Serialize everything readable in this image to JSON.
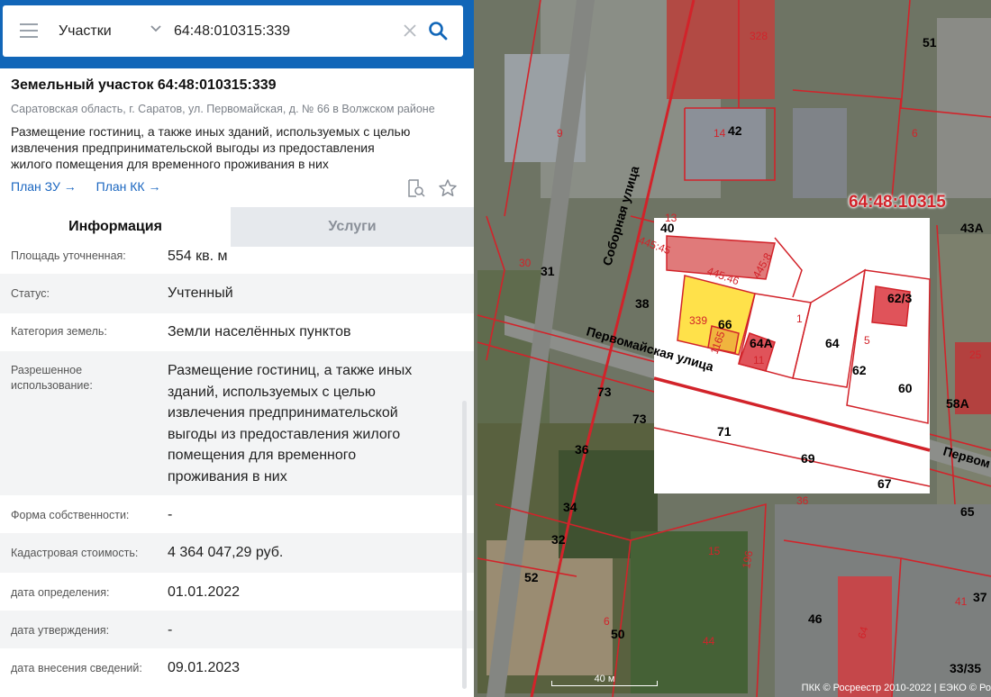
{
  "search": {
    "type_label": "Участки",
    "query": "64:48:010315:339"
  },
  "object": {
    "title": "Земельный участок 64:48:010315:339",
    "address": "Саратовская область, г. Саратов, ул. Первомайская, д. № 66 в Волжском районе",
    "purpose_lines": [
      "Размещение гостиниц, а также иных зданий, используемых с целью",
      "извлечения предпринимательской выгоды из предоставления",
      "жилого помещения для временного проживания в них"
    ],
    "links": [
      "План ЗУ →",
      "План КК →"
    ]
  },
  "tabs": [
    "Информация",
    "Услуги"
  ],
  "info_rows": [
    {
      "key": "Площадь уточненная:",
      "value": "554 кв. м"
    },
    {
      "key": "Статус:",
      "value": "Учтенный"
    },
    {
      "key": "Категория земель:",
      "value": "Земли населённых пунктов"
    },
    {
      "key_lines": [
        "Разрешенное",
        "использование:"
      ],
      "value_lines": [
        "Размещение гостиниц, а также иных",
        "зданий, используемых с целью",
        "извлечения предпринимательской",
        "выгоды из предоставления жилого",
        "помещения для временного",
        "проживания в них"
      ]
    },
    {
      "key": "Форма собственности:",
      "value": "-"
    },
    {
      "key": "Кадастровая стоимость:",
      "value": "4 364 047,29 руб."
    },
    {
      "key": "дата определения:",
      "value": "01.01.2022"
    },
    {
      "key": "дата утверждения:",
      "value": "-"
    },
    {
      "key": "дата внесения сведений:",
      "value": "09.01.2023"
    }
  ],
  "map": {
    "quarter": "64:48:10315",
    "streets": [
      "Первомайская улица",
      "Соборная улица",
      "Первом"
    ],
    "black_labels": [
      "51",
      "42",
      "40",
      "31",
      "38",
      "66",
      "64А",
      "64",
      "62/3",
      "62",
      "60",
      "43А",
      "73",
      "73",
      "36",
      "71",
      "69",
      "67",
      "58А",
      "34",
      "32",
      "52",
      "50",
      "46",
      "65",
      "37",
      "33/35"
    ],
    "red_labels": [
      "328",
      "9",
      "14",
      "6",
      "13",
      "30",
      "445:45",
      "445:46",
      "445:8",
      "339",
      "1165",
      "1",
      "5",
      "11",
      "36",
      "15",
      "196",
      "44",
      "6",
      "64",
      "41",
      "25"
    ],
    "scale": "40 м",
    "copyright": "ПКК © Росреестр 2010-2022 | ЕЭКО © Ро",
    "colors": {
      "parcel_highlight": "#ffe14a",
      "boundary": "#d2232a",
      "panel_header": "#1166b8"
    }
  }
}
